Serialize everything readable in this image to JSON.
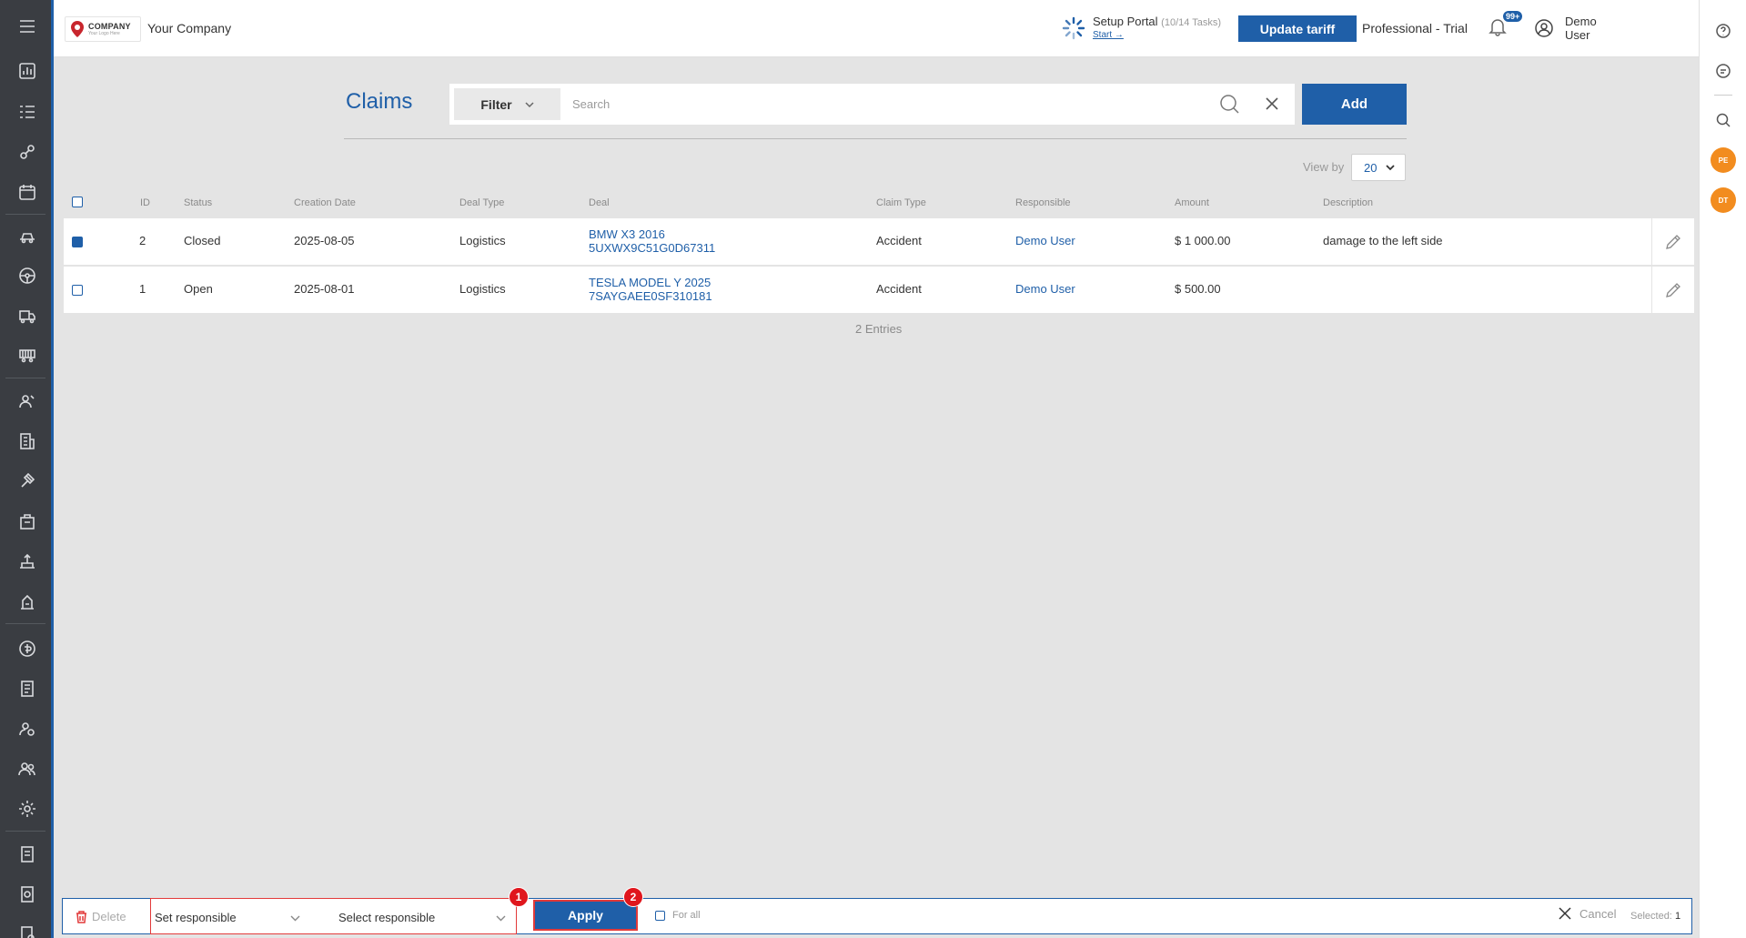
{
  "company": {
    "logo_title": "COMPANY",
    "logo_subtitle": "Your Logo Here",
    "name": "Your Company"
  },
  "topbar": {
    "setup_title": "Setup Portal",
    "setup_tasks": "(10/14 Tasks)",
    "setup_start": "Start →",
    "update_tariff_label": "Update tariff",
    "plan": "Professional - Trial",
    "notifications_badge": "99+",
    "user_first": "Demo",
    "user_last": "User"
  },
  "right_rail": {
    "avatars": [
      "PE",
      "DT"
    ]
  },
  "page": {
    "title": "Claims",
    "filter_label": "Filter",
    "search_placeholder": "Search",
    "add_label": "Add",
    "view_by_label": "View by",
    "view_by_value": "20",
    "entries_text": "2 Entries"
  },
  "table": {
    "columns": [
      "ID",
      "Status",
      "Creation Date",
      "Deal Type",
      "Deal",
      "Claim Type",
      "Responsible",
      "Amount",
      "Description"
    ],
    "rows": [
      {
        "checked": true,
        "id": "2",
        "status": "Closed",
        "creation_date": "2025-08-05",
        "deal_type": "Logistics",
        "deal_line1": "BMW X3 2016",
        "deal_line2": "5UXWX9C51G0D67311",
        "claim_type": "Accident",
        "responsible": "Demo User",
        "amount": "$ 1 000.00",
        "description": "damage to the left side"
      },
      {
        "checked": false,
        "id": "1",
        "status": "Open",
        "creation_date": "2025-08-01",
        "deal_type": "Logistics",
        "deal_line1": "TESLA MODEL Y 2025",
        "deal_line2": "7SAYGAEE0SF310181",
        "claim_type": "Accident",
        "responsible": "Demo User",
        "amount": "$ 500.00",
        "description": ""
      }
    ]
  },
  "bulk_bar": {
    "delete_label": "Delete",
    "action_select": "Set responsible",
    "responsible_select": "Select responsible",
    "apply_label": "Apply",
    "for_all_label": "For all",
    "cancel_label": "Cancel",
    "selected_label": "Selected:",
    "selected_count": "1",
    "marker_1": "1",
    "marker_2": "2"
  },
  "colors": {
    "primary": "#1f5fa8",
    "sidebar": "#3a3d42",
    "highlight": "#e23a3a",
    "avatar": "#f28c1f"
  }
}
